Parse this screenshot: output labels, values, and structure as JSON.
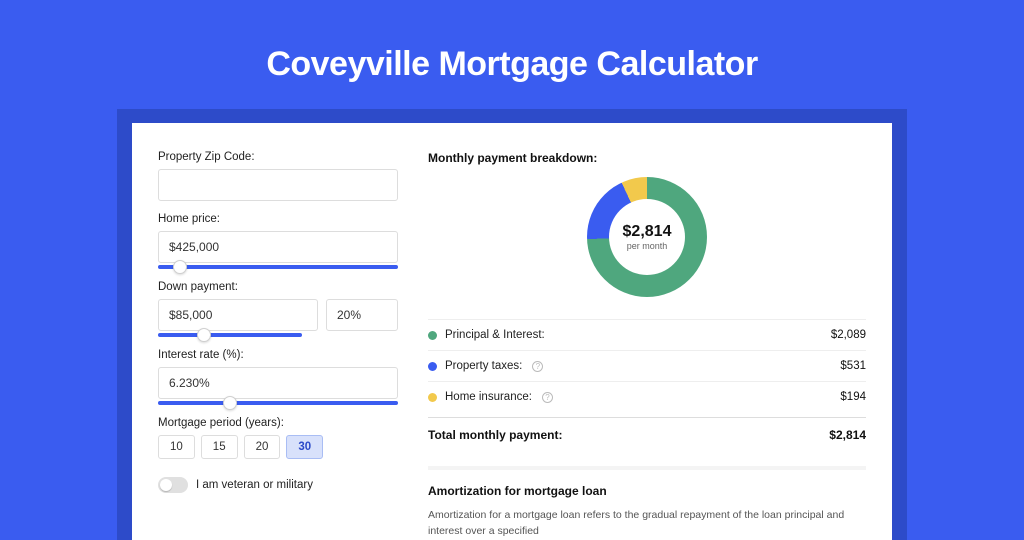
{
  "title": "Coveyville Mortgage Calculator",
  "form": {
    "zip": {
      "label": "Property Zip Code:",
      "value": ""
    },
    "home_price": {
      "label": "Home price:",
      "value": "$425,000",
      "slider_pos": 9
    },
    "down_payment": {
      "label": "Down payment:",
      "amount": "$85,000",
      "percent": "20%",
      "slider_pos": 20
    },
    "interest_rate": {
      "label": "Interest rate (%):",
      "value": "6.230%",
      "slider_pos": 30
    },
    "period": {
      "label": "Mortgage period (years):",
      "options": [
        "10",
        "15",
        "20",
        "30"
      ],
      "selected": "30"
    },
    "veteran": {
      "label": "I am veteran or military",
      "checked": false
    }
  },
  "breakdown": {
    "heading": "Monthly payment breakdown:",
    "center_amount": "$2,814",
    "center_sub": "per month",
    "rows": [
      {
        "color": "green",
        "label": "Principal & Interest:",
        "info": false,
        "value": "$2,089"
      },
      {
        "color": "blue",
        "label": "Property taxes:",
        "info": true,
        "value": "$531"
      },
      {
        "color": "yellow",
        "label": "Home insurance:",
        "info": true,
        "value": "$194"
      }
    ],
    "total_label": "Total monthly payment:",
    "total_value": "$2,814"
  },
  "amort": {
    "title": "Amortization for mortgage loan",
    "text": "Amortization for a mortgage loan refers to the gradual repayment of the loan principal and interest over a specified"
  },
  "chart_data": {
    "type": "pie",
    "title": "Monthly payment breakdown",
    "series": [
      {
        "name": "Principal & Interest",
        "value": 2089,
        "color": "#4fa77e"
      },
      {
        "name": "Property taxes",
        "value": 531,
        "color": "#3a5cf0"
      },
      {
        "name": "Home insurance",
        "value": 194,
        "color": "#f2c94c"
      }
    ],
    "total": 2814,
    "center_label": "$2,814 per month"
  }
}
